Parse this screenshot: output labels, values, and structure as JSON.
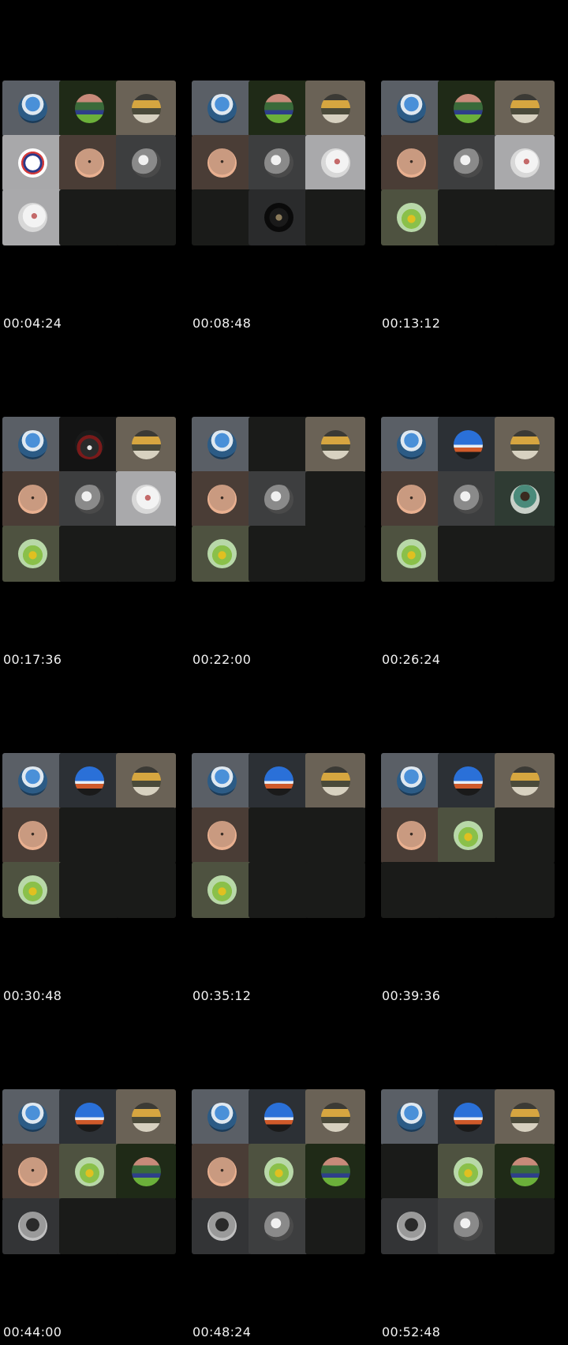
{
  "frames": [
    {
      "time": "00:04:24",
      "tiles": [
        "sea",
        "field",
        "sunset",
        "logo",
        "orange",
        "gray",
        "white",
        "empty",
        "empty"
      ]
    },
    {
      "time": "00:08:48",
      "tiles": [
        "sea",
        "field",
        "sunset",
        "orange",
        "gray",
        "white",
        "empty",
        "dark",
        "empty"
      ]
    },
    {
      "time": "00:13:12",
      "tiles": [
        "sea",
        "field",
        "sunset",
        "orange",
        "gray",
        "white",
        "green",
        "empty",
        "empty"
      ]
    },
    {
      "time": "00:17:36",
      "tiles": [
        "sea",
        "man",
        "sunset",
        "orange",
        "gray",
        "white",
        "green",
        "empty",
        "empty"
      ]
    },
    {
      "time": "00:22:00",
      "tiles": [
        "sea",
        "empty",
        "sunset",
        "orange",
        "gray",
        "empty",
        "green",
        "empty",
        "empty"
      ]
    },
    {
      "time": "00:26:24",
      "tiles": [
        "sea",
        "sky",
        "sunset",
        "orange",
        "gray",
        "woman",
        "green",
        "empty",
        "empty"
      ]
    },
    {
      "time": "00:30:48",
      "tiles": [
        "sea",
        "sky",
        "sunset",
        "orange",
        "empty",
        "empty",
        "green",
        "empty",
        "empty"
      ]
    },
    {
      "time": "00:35:12",
      "tiles": [
        "sea",
        "sky",
        "sunset",
        "orange",
        "empty",
        "empty",
        "green",
        "empty",
        "empty"
      ]
    },
    {
      "time": "00:39:36",
      "tiles": [
        "sea",
        "sky",
        "sunset",
        "orange",
        "green",
        "empty",
        "empty",
        "empty",
        "empty"
      ]
    },
    {
      "time": "00:44:00",
      "tiles": [
        "sea",
        "sky",
        "sunset",
        "orange",
        "green",
        "field",
        "person",
        "empty",
        "empty"
      ]
    },
    {
      "time": "00:48:24",
      "tiles": [
        "sea",
        "sky",
        "sunset",
        "orange",
        "green",
        "field",
        "person",
        "gray",
        "empty"
      ]
    },
    {
      "time": "00:52:48",
      "tiles": [
        "sea",
        "sky",
        "sunset",
        "empty",
        "green",
        "field",
        "person",
        "gray",
        "empty"
      ]
    }
  ],
  "tile_names": {
    "sea": "participant-tile-sea-avatar",
    "field": "participant-tile-field-avatar",
    "sunset": "participant-tile-sunset-avatar",
    "logo": "participant-tile-logo-avatar",
    "orange": "participant-tile-orange-avatar",
    "gray": "participant-tile-gray-avatar",
    "white": "participant-tile-white-avatar",
    "green": "participant-tile-green-avatar",
    "dark": "participant-tile-dark-avatar",
    "man": "participant-tile-man-avatar",
    "sky": "participant-tile-sky-avatar",
    "woman": "participant-tile-woman-avatar",
    "person": "participant-tile-person-avatar",
    "empty": "participant-tile-empty"
  }
}
